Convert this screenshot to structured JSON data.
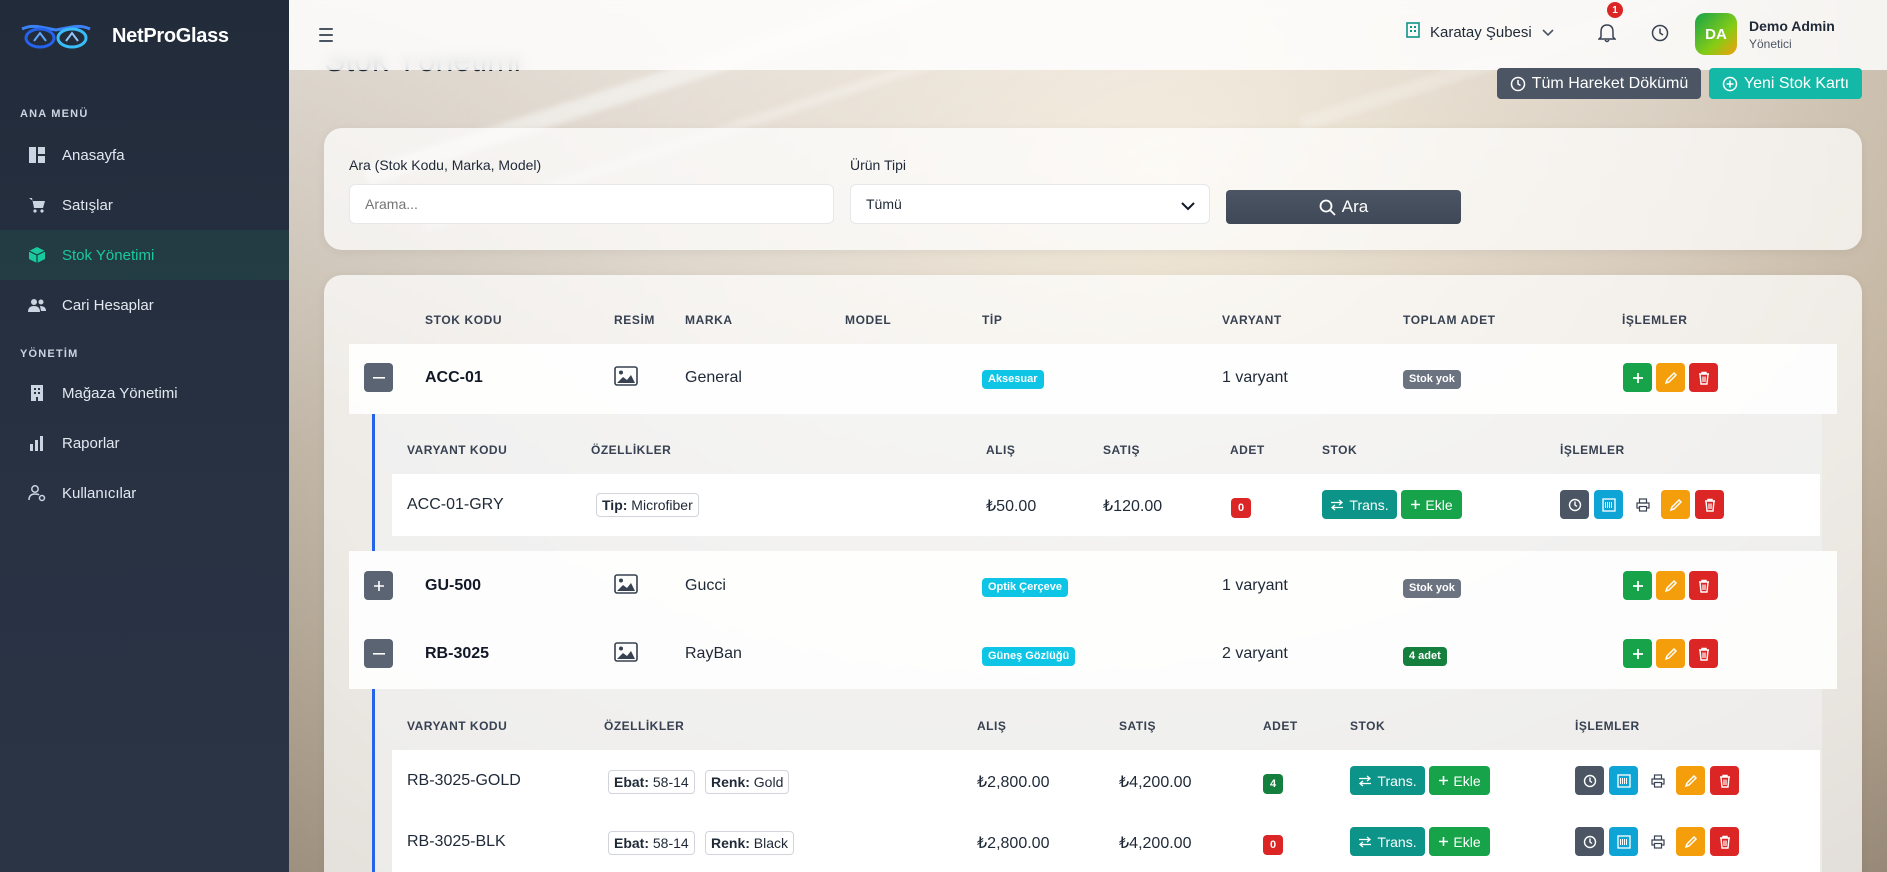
{
  "brand": {
    "name": "NetProGlass"
  },
  "sidebar": {
    "section_main": "ANA MENÜ",
    "section_admin": "YÖNETİM",
    "items": [
      {
        "label": "Anasayfa",
        "icon": "dashboard-icon"
      },
      {
        "label": "Satışlar",
        "icon": "cart-icon"
      },
      {
        "label": "Stok Yönetimi",
        "icon": "box-icon",
        "active": true
      },
      {
        "label": "Cari Hesaplar",
        "icon": "users-icon"
      },
      {
        "label": "Mağaza Yönetimi",
        "icon": "building-icon"
      },
      {
        "label": "Raporlar",
        "icon": "bar-chart-icon"
      },
      {
        "label": "Kullanıcılar",
        "icon": "user-gear-icon"
      }
    ]
  },
  "topbar": {
    "branch": "Karatay Şubesi",
    "notification_count": "1",
    "user_initials": "DA",
    "user_name": "Demo Admin",
    "user_role": "Yönetici"
  },
  "page": {
    "title": "Stok Yönetimi",
    "btn_history": "Tüm Hareket Dökümü",
    "btn_new": "Yeni Stok Kartı"
  },
  "filter": {
    "search_label": "Ara (Stok Kodu, Marka, Model)",
    "search_placeholder": "Arama...",
    "type_label": "Ürün Tipi",
    "type_value": "Tümü",
    "search_button": "Ara"
  },
  "table": {
    "headers": [
      "STOK KODU",
      "RESİM",
      "MARKA",
      "MODEL",
      "TİP",
      "VARYANT",
      "TOPLAM ADET",
      "İŞLEMLER"
    ],
    "rows": [
      {
        "code": "ACC-01",
        "brand": "General",
        "model": "",
        "type": "Aksesuar",
        "variants": "1 varyant",
        "total": "Stok yok",
        "expanded": true
      },
      {
        "code": "GU-500",
        "brand": "Gucci",
        "model": "",
        "type": "Optik Çerçeve",
        "variants": "1 varyant",
        "total": "Stok yok",
        "expanded": false
      },
      {
        "code": "RB-3025",
        "brand": "RayBan",
        "model": "",
        "type": "Güneş Gözlüğü",
        "variants": "2 varyant",
        "total": "4 adet",
        "expanded": true
      }
    ]
  },
  "variants": {
    "headers": [
      "VARYANT KODU",
      "ÖZELLİKLER",
      "ALIŞ",
      "SATIŞ",
      "ADET",
      "STOK",
      "İŞLEMLER"
    ],
    "trans_label": "Trans.",
    "ekle_label": "Ekle",
    "acc01": [
      {
        "code": "ACC-01-GRY",
        "attrs": [
          {
            "k": "Tip:",
            "v": "Microfiber"
          }
        ],
        "buy": "₺50.00",
        "sell": "₺120.00",
        "qty": "0"
      }
    ],
    "rb3025": [
      {
        "code": "RB-3025-GOLD",
        "attrs": [
          {
            "k": "Ebat:",
            "v": "58-14"
          },
          {
            "k": "Renk:",
            "v": "Gold"
          }
        ],
        "buy": "₺2,800.00",
        "sell": "₺4,200.00",
        "qty": "4"
      },
      {
        "code": "RB-3025-BLK",
        "attrs": [
          {
            "k": "Ebat:",
            "v": "58-14"
          },
          {
            "k": "Renk:",
            "v": "Black"
          }
        ],
        "buy": "₺2,800.00",
        "sell": "₺4,200.00",
        "qty": "0"
      }
    ]
  },
  "colors": {
    "sidebar_bg": "#222b3a",
    "accent_teal": "#14b8a6",
    "success": "#16a34a",
    "warning": "#f59e0b",
    "danger": "#dc2626",
    "info": "#0ec5e6"
  }
}
